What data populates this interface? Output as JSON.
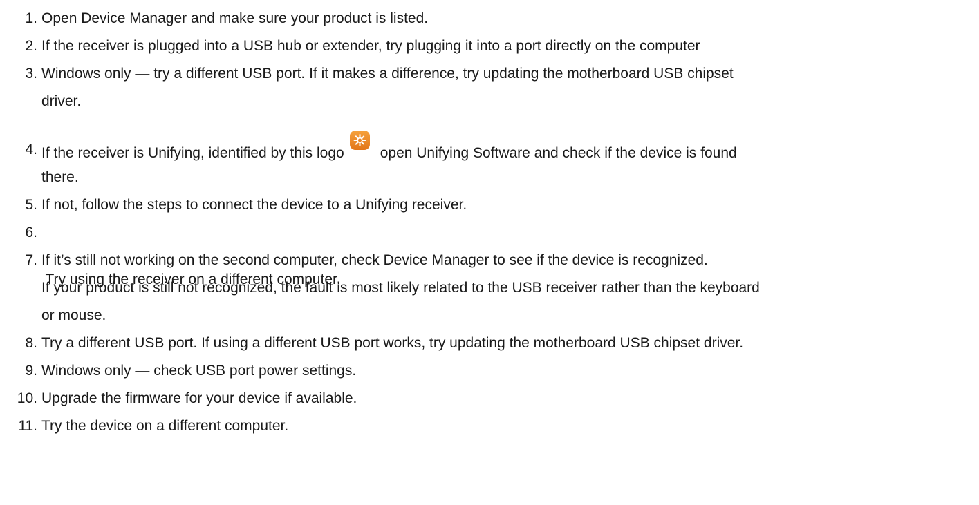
{
  "steps": [
    {
      "number": "1.",
      "lines": [
        "Open Device Manager and make sure your product is listed."
      ]
    },
    {
      "number": "2.",
      "lines": [
        "If the receiver is plugged into a USB hub or extender, try plugging it into a port directly on the computer"
      ]
    },
    {
      "number": "3.",
      "lines": [
        "Windows only — try a different USB port. If it makes a difference, try updating the motherboard USB chipset",
        "driver."
      ]
    },
    {
      "number": "4.",
      "line1_before": "If the receiver is Unifying, identified by this logo",
      "line1_after": "open Unifying Software and check if the device is found",
      "line2": "there.",
      "logo_icon": "unifying-logo-icon",
      "logo_color": "#f28a1e"
    },
    {
      "number": "5.",
      "lines": [
        "If not, follow the steps to connect the device to a Unifying receiver."
      ]
    },
    {
      "number": "6.",
      "lines": [
        " Try using the receiver on a different computer."
      ]
    },
    {
      "number": "7.",
      "lines": [
        "If it’s still not working on the second computer, check Device Manager to see if the device is recognized.",
        "If your product is still not recognized, the fault is most likely related to the USB receiver rather than the keyboard",
        "or mouse."
      ]
    },
    {
      "number": "8.",
      "lines": [
        "Try a different USB port. If using a different USB port works, try updating the motherboard USB chipset driver."
      ]
    },
    {
      "number": "9.",
      "lines": [
        "Windows only — check USB port power settings."
      ]
    },
    {
      "number": "10.",
      "lines": [
        "Upgrade the firmware for your device if available."
      ]
    },
    {
      "number": "11.",
      "lines": [
        "Try the device on a different computer."
      ]
    }
  ]
}
